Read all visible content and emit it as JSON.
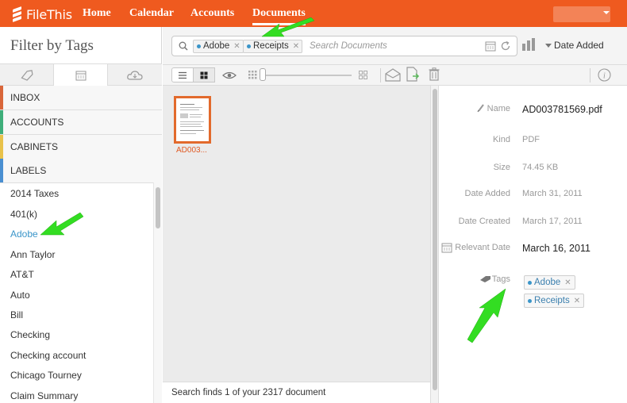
{
  "app": {
    "name": "FileThis"
  },
  "nav": {
    "items": [
      {
        "label": "Home"
      },
      {
        "label": "Calendar"
      },
      {
        "label": "Accounts"
      },
      {
        "label": "Documents"
      }
    ]
  },
  "filter": {
    "title": "Filter by Tags",
    "tabs": [
      {
        "icon": "tag-icon"
      },
      {
        "icon": "calendar-icon"
      },
      {
        "icon": "cloud-icon"
      }
    ],
    "sections": [
      {
        "label": "INBOX",
        "color": "#d9663a"
      },
      {
        "label": "ACCOUNTS",
        "color": "#3fae7a"
      },
      {
        "label": "CABINETS",
        "color": "#e8c24a"
      },
      {
        "label": "LABELS",
        "color": "#4a8fd1"
      }
    ],
    "tags": [
      "2014 Taxes",
      "401(k)",
      "Adobe",
      "Ann Taylor",
      "AT&T",
      "Auto",
      "Bill",
      "Checking",
      "Checking account",
      "Chicago Tourney",
      "Claim Summary"
    ],
    "selected_tag": "Adobe"
  },
  "search": {
    "chips": [
      {
        "label": "Adobe"
      },
      {
        "label": "Receipts"
      }
    ],
    "placeholder": "Search Documents",
    "sort_label": "Date Added"
  },
  "documents": {
    "items": [
      {
        "name": "AD003..."
      }
    ],
    "status": "Search finds 1 of your 2317 document"
  },
  "details": {
    "name_label": "Name",
    "name_value": "AD003781569.pdf",
    "kind_label": "Kind",
    "kind_value": "PDF",
    "size_label": "Size",
    "size_value": "74.45 KB",
    "date_added_label": "Date Added",
    "date_added_value": "March 31, 2011",
    "date_created_label": "Date Created",
    "date_created_value": "March 17, 2011",
    "relevant_date_label": "Relevant Date",
    "relevant_date_value": "March 16, 2011",
    "tags_label": "Tags",
    "tags": [
      {
        "label": "Adobe"
      },
      {
        "label": "Receipts"
      }
    ]
  },
  "colors": {
    "brand": "#ef5a1f",
    "tag_blue": "#3a95c9",
    "annotation_arrow": "#33dd22"
  }
}
